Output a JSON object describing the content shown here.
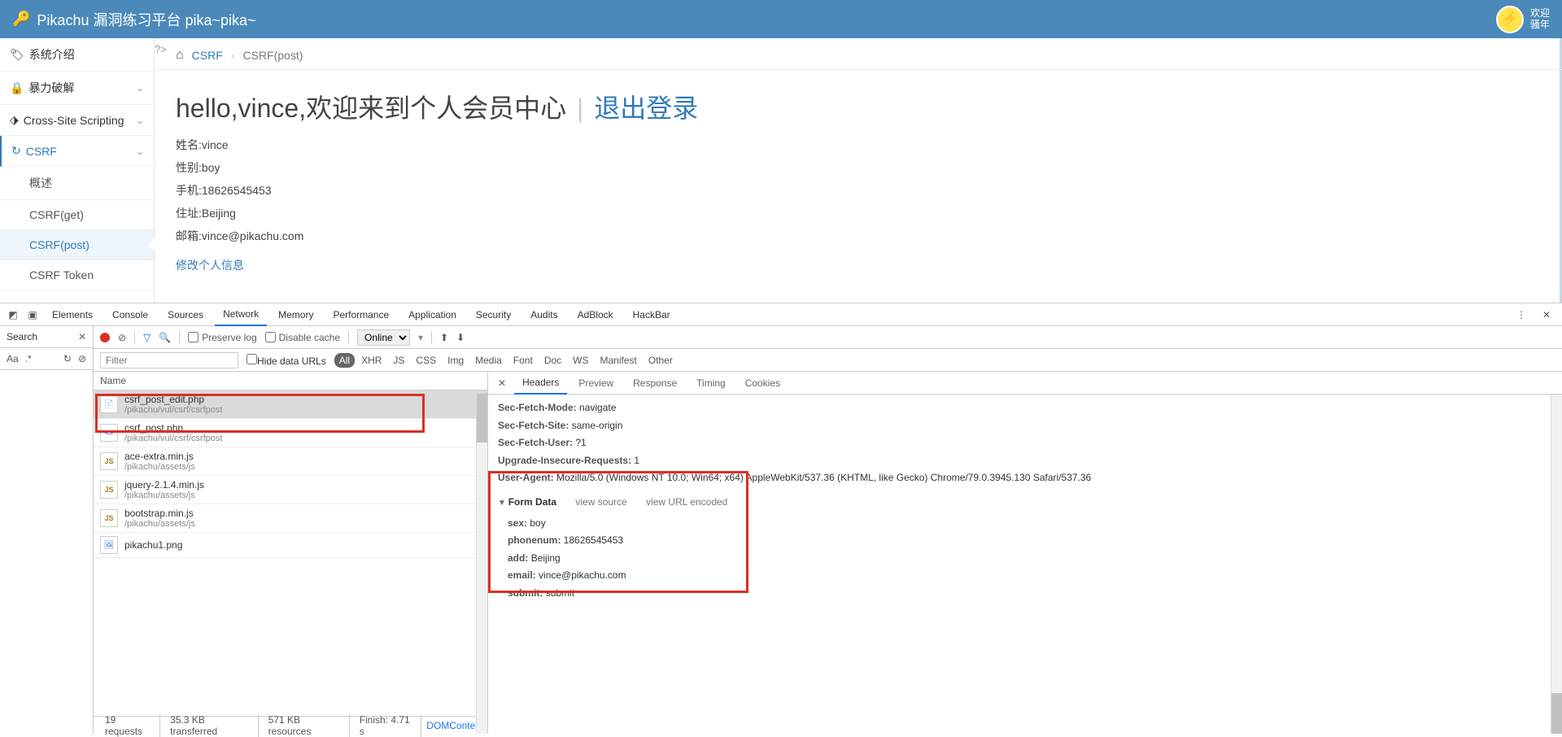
{
  "header": {
    "title": "Pikachu 漏洞练习平台 pika~pika~",
    "welcome_l1": "欢迎",
    "welcome_l2": "骚年"
  },
  "sidebar": {
    "items": [
      {
        "icon": "🏷",
        "label": "系统介绍"
      },
      {
        "icon": "🔒",
        "label": "暴力破解",
        "chev": "⌄"
      },
      {
        "icon": "⬗",
        "label": "Cross-Site Scripting",
        "chev": "⌄"
      },
      {
        "icon": "↻",
        "label": "CSRF",
        "chev": "⌄",
        "active": true
      }
    ],
    "subs": [
      {
        "label": "概述"
      },
      {
        "label": "CSRF(get)"
      },
      {
        "label": "CSRF(post)",
        "active": true
      },
      {
        "label": "CSRF Token"
      }
    ]
  },
  "breadcrumb": {
    "home_icon": "⌂",
    "parent": "CSRF",
    "sep": "›",
    "current": "CSRF(post)"
  },
  "php_tag": "?>",
  "page": {
    "title_hello": "hello,vince,欢迎来到个人会员中心",
    "divider": " | ",
    "logout": "退出登录",
    "lines": {
      "name": "姓名:vince",
      "sex": "性别:boy",
      "phone": "手机:18626545453",
      "addr": "住址:Beijing",
      "email": "邮箱:vince@pikachu.com"
    },
    "edit": "修改个人信息"
  },
  "devtools": {
    "tabs": [
      "Elements",
      "Console",
      "Sources",
      "Network",
      "Memory",
      "Performance",
      "Application",
      "Security",
      "Audits",
      "AdBlock",
      "HackBar"
    ],
    "active_tab": "Network",
    "search": {
      "label": "Search",
      "aa": "Aa",
      "re": ".*",
      "refresh": "↻",
      "clear": "⊘"
    },
    "net_toolbar": {
      "preserve": "Preserve log",
      "disable": "Disable cache",
      "online": "Online",
      "upload": "⬆",
      "download": "⬇"
    },
    "filter": {
      "placeholder": "Filter",
      "hide": "Hide data URLs",
      "types": [
        "All",
        "XHR",
        "JS",
        "CSS",
        "Img",
        "Media",
        "Font",
        "Doc",
        "WS",
        "Manifest",
        "Other"
      ],
      "active_type": "All"
    },
    "columns": {
      "name": "Name"
    },
    "requests": [
      {
        "ic": "doc",
        "name": "csrf_post_edit.php",
        "path": "/pikachu/vul/csrf/csrfpost",
        "selected": true
      },
      {
        "ic": "code",
        "name": "csrf_post.php",
        "path": "/pikachu/vul/csrf/csrfpost"
      },
      {
        "ic": "js",
        "name": "ace-extra.min.js",
        "path": "/pikachu/assets/js"
      },
      {
        "ic": "js",
        "name": "jquery-2.1.4.min.js",
        "path": "/pikachu/assets/js"
      },
      {
        "ic": "js",
        "name": "bootstrap.min.js",
        "path": "/pikachu/assets/js"
      },
      {
        "ic": "img",
        "name": "pikachu1.png",
        "path": ""
      }
    ],
    "status": {
      "reqs": "19 requests",
      "transferred": "35.3 KB transferred",
      "resources": "571 KB resources",
      "finish": "Finish: 4.71 s",
      "dom": "DOMConten"
    },
    "detail_tabs": [
      "Headers",
      "Preview",
      "Response",
      "Timing",
      "Cookies"
    ],
    "active_detail": "Headers",
    "headers": [
      {
        "k": "Sec-Fetch-Mode:",
        "v": "navigate"
      },
      {
        "k": "Sec-Fetch-Site:",
        "v": "same-origin"
      },
      {
        "k": "Sec-Fetch-User:",
        "v": "?1"
      },
      {
        "k": "Upgrade-Insecure-Requests:",
        "v": "1"
      },
      {
        "k": "User-Agent:",
        "v": "Mozilla/5.0 (Windows NT 10.0; Win64; x64) AppleWebKit/537.36 (KHTML, like Gecko) Chrome/79.0.3945.130 Safari/537.36"
      }
    ],
    "form_section": {
      "title": "Form Data",
      "view_source": "view source",
      "view_url": "view URL encoded"
    },
    "form_data": [
      {
        "k": "sex:",
        "v": "boy"
      },
      {
        "k": "phonenum:",
        "v": "18626545453"
      },
      {
        "k": "add:",
        "v": "Beijing"
      },
      {
        "k": "email:",
        "v": "vince@pikachu.com"
      },
      {
        "k": "submit:",
        "v": "submit"
      }
    ]
  }
}
